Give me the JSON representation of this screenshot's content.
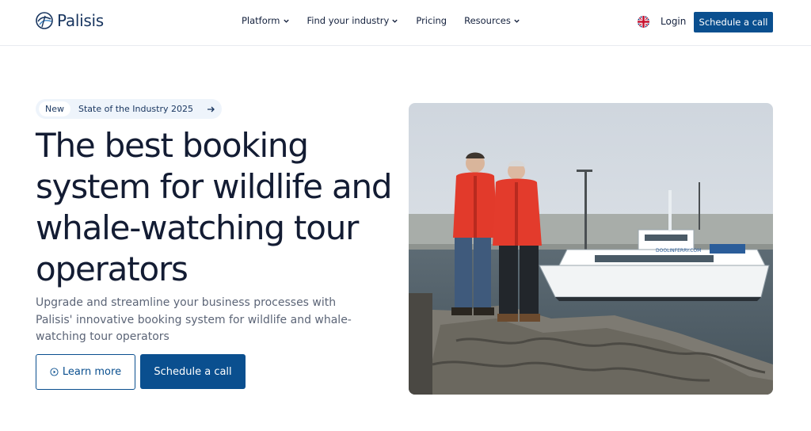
{
  "brand": {
    "name": "Palisis",
    "color": "#18355f",
    "accent": "#0a4f8f"
  },
  "nav": {
    "items": [
      {
        "label": "Platform",
        "dropdown": true
      },
      {
        "label": "Find your industry",
        "dropdown": true
      },
      {
        "label": "Pricing",
        "dropdown": false
      },
      {
        "label": "Resources",
        "dropdown": true
      }
    ],
    "language_icon": "uk-flag-icon",
    "login_label": "Login",
    "cta_label": "Schedule a call"
  },
  "hero": {
    "pill": {
      "badge": "New",
      "text": "State of the Industry 2025",
      "icon": "arrow-right-icon"
    },
    "headline": "The best booking system for wildlife and whale-watching tour operators",
    "subtext": "Upgrade and streamline your business processes with Palisis' innovative booking system for wildlife and whale-watching tour operators",
    "learn_more_label": "Learn more",
    "schedule_label": "Schedule a call",
    "image_text": "DOOLINFERRY.COM"
  }
}
